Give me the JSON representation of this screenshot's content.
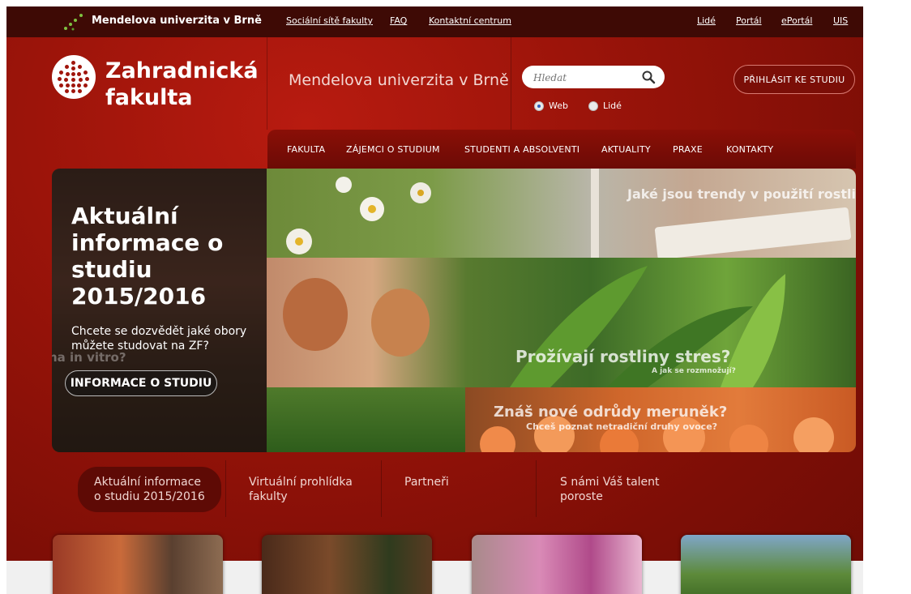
{
  "topbar": {
    "university": "Mendelova univerzita v Brně",
    "links_left": [
      "Sociální sítě fakulty",
      "FAQ",
      "Kontaktní centrum"
    ],
    "links_right": [
      "Lidé",
      "Portál",
      "ePortál",
      "UIS"
    ]
  },
  "header": {
    "faculty_line1": "Zahradnická",
    "faculty_line2": "fakulta",
    "university_name": "Mendelova univerzita v Brně",
    "search_placeholder": "Hledat",
    "search_options": {
      "web": "Web",
      "people": "Lidé",
      "selected": "Web"
    },
    "apply_button": "PŘIHLÁSIT KE STUDIU"
  },
  "nav": {
    "items": [
      "FAKULTA",
      "ZÁJEMCI O STUDIUM",
      "STUDENTI A ABSOLVENTI",
      "AKTUALITY",
      "PRAXE",
      "KONTAKTY"
    ]
  },
  "banner": {
    "title": "Aktuální informace o studiu 2015/2016",
    "subtitle": "Chcete se dozvědět jaké obory můžete studovat na ZF?",
    "button": "INFORMACE O STUDIU",
    "captions": {
      "trends": "Jaké jsou trendy v použití rostlin?",
      "stress": "Prožívají rostliny stres?",
      "stress_sub": "A jak se rozmnožují?",
      "apricot": "Znáš nové odrůdy meruněk?",
      "apricot_sub": "Chceš poznat netradiční druhy ovoce?",
      "vitro": "na in vitro?"
    }
  },
  "tabs": [
    {
      "label_line1": "Aktuální informace",
      "label_line2": "o studiu 2015/2016",
      "active": true
    },
    {
      "label_line1": "Virtuální prohlídka",
      "label_line2": "fakulty",
      "active": false
    },
    {
      "label_line1": "Partneři",
      "label_line2": "",
      "active": false
    },
    {
      "label_line1": "S námi Váš talent",
      "label_line2": "poroste",
      "active": false
    }
  ],
  "colors": {
    "brand_red": "#8e1108",
    "topbar_dark": "#3e0a05",
    "radio_selected": "#2d5fbd"
  }
}
